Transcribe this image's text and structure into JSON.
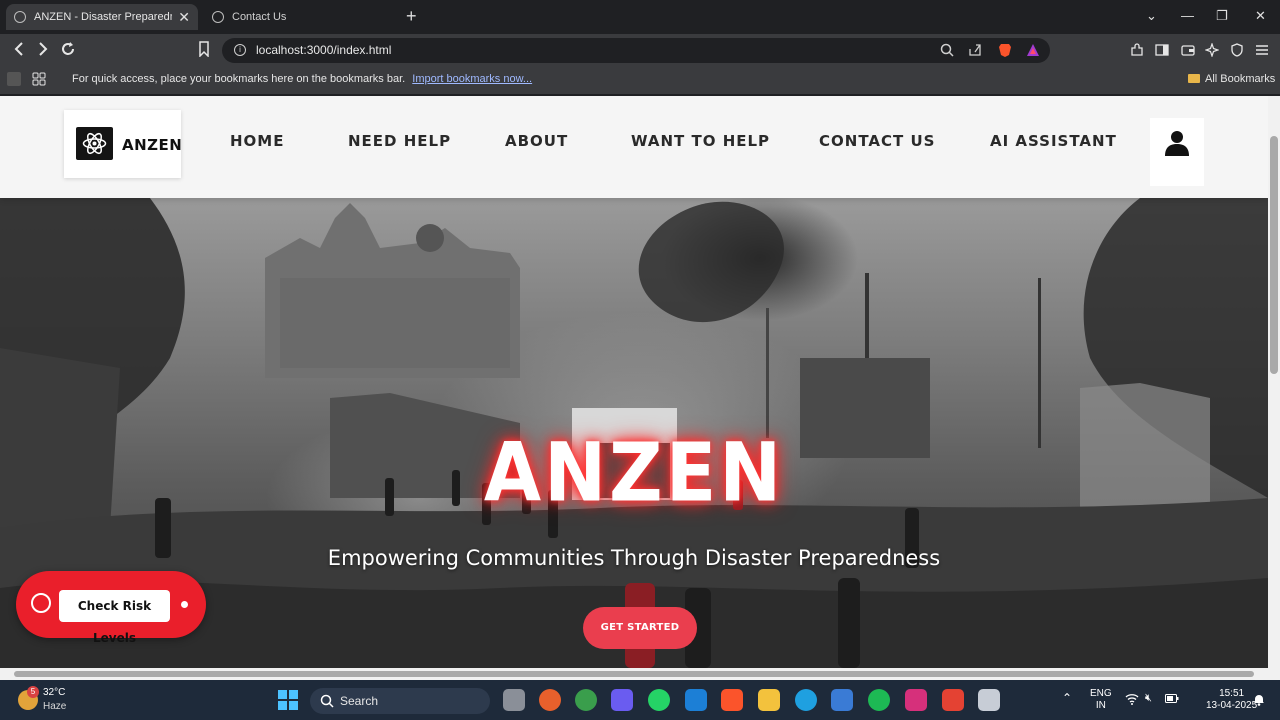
{
  "browser": {
    "tabs": [
      {
        "title": "ANZEN - Disaster Preparedness",
        "active": true
      },
      {
        "title": "Contact Us",
        "active": false
      }
    ],
    "url": "localhost:3000/index.html",
    "bookmarks_bar": {
      "message": "For quick access, place your bookmarks here on the bookmarks bar.",
      "import_link": "Import bookmarks now...",
      "all_bookmarks": "All Bookmarks"
    }
  },
  "site": {
    "logo_text": "ANZEN",
    "nav": [
      "HOME",
      "NEED HELP",
      "ABOUT",
      "WANT TO HELP",
      "CONTACT US",
      "AI ASSISTANT"
    ],
    "hero": {
      "title": "ANZEN",
      "subtitle": "Empowering Communities Through Disaster Preparedness",
      "cta": "GET STARTED"
    },
    "risk_widget": {
      "label": "Check Risk Levels"
    },
    "colors": {
      "accent": "#ea3e4e",
      "widget": "#ea1f2b",
      "header_bg": "#f5f5f5"
    }
  },
  "taskbar": {
    "weather": {
      "temp": "32°C",
      "condition": "Haze",
      "badge": "5"
    },
    "search": "Search",
    "language": {
      "line1": "ENG",
      "line2": "IN"
    },
    "clock": {
      "time": "15:51",
      "date": "13-04-2025"
    }
  }
}
